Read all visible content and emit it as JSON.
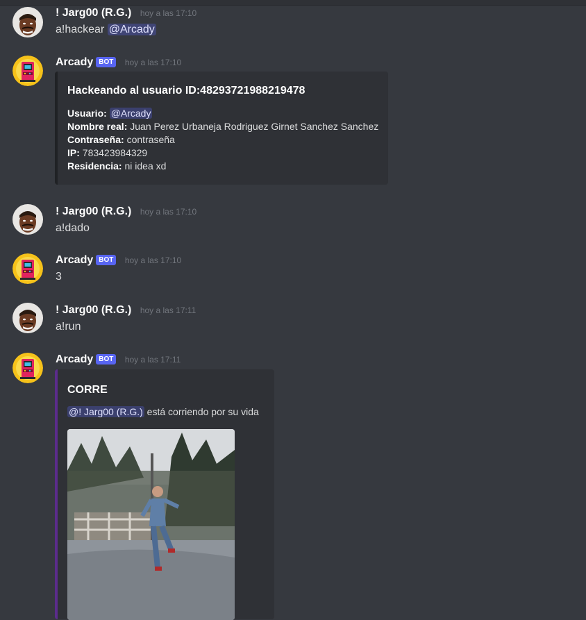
{
  "channel": {
    "messages": [
      {
        "author": "! Jarg00 (R.G.)",
        "timestamp": "hoy a las 17:10",
        "text": "a!hackear ",
        "mention": "@Arcady",
        "avatar_icon": "face-avatar-icon"
      },
      {
        "author": "Arcady",
        "bot_tag": "BOT",
        "timestamp": "hoy a las 17:10",
        "avatar_icon": "arcade-avatar-icon",
        "embed": {
          "title": "Hackeando al usuario ID:48293721988219478",
          "fields": [
            {
              "label": "Usuario:",
              "value": "@Arcady"
            },
            {
              "label": "Nombre real:",
              "value": "Juan Perez Urbaneja Rodriguez Girnet Sanchez Sanchez"
            },
            {
              "label": "Contraseña:",
              "value": "contraseña"
            },
            {
              "label": "IP:",
              "value": "783423984329"
            },
            {
              "label": "Residencia:",
              "value": "ni idea xd"
            }
          ]
        }
      },
      {
        "author": "! Jarg00 (R.G.)",
        "timestamp": "hoy a las 17:10",
        "text": "a!dado",
        "avatar_icon": "face-avatar-icon"
      },
      {
        "author": "Arcady",
        "bot_tag": "BOT",
        "timestamp": "hoy a las 17:10",
        "text": "3",
        "avatar_icon": "arcade-avatar-icon"
      },
      {
        "author": "! Jarg00 (R.G.)",
        "timestamp": "hoy a las 17:11",
        "text": "a!run",
        "avatar_icon": "face-avatar-icon"
      },
      {
        "author": "Arcady",
        "bot_tag": "BOT",
        "timestamp": "hoy a las 17:11",
        "avatar_icon": "arcade-avatar-icon",
        "embed": {
          "title": "CORRE",
          "mention": "@! Jarg00 (R.G.)",
          "description": " está corriendo por su vida",
          "image_icon": "running-man-gif-icon",
          "accent_color": "#5b2c8c"
        }
      }
    ]
  },
  "colors": {
    "background": "#36393f",
    "embed_bg": "#2f3136",
    "bot_tag": "#5865f2",
    "mention_bg": "rgba(88,101,242,0.3)",
    "timestamp": "#72767d"
  }
}
